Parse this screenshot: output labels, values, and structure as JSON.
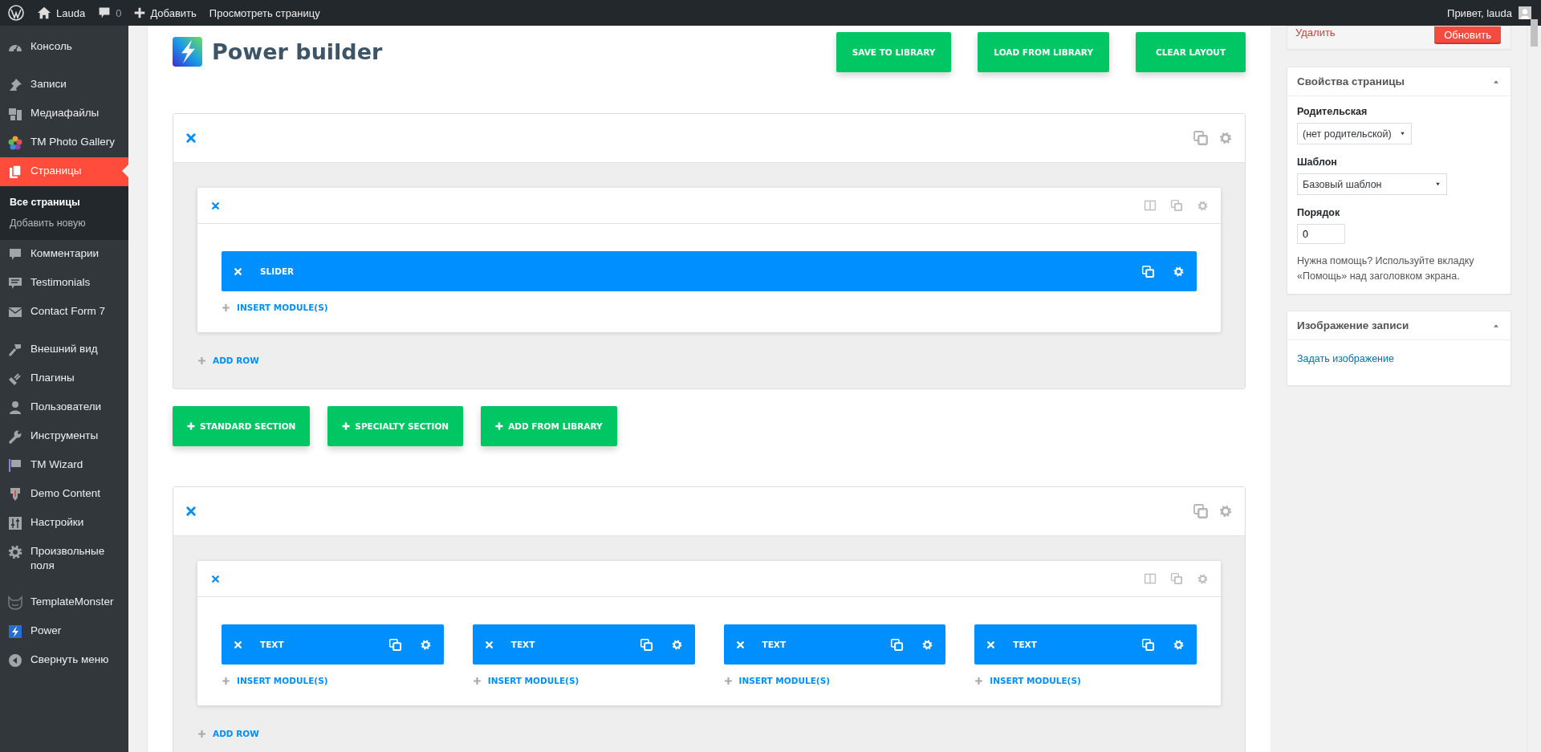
{
  "admin_bar": {
    "site": "Lauda",
    "comments": "0",
    "new": "Добавить",
    "view": "Просмотреть страницу",
    "greeting": "Привет, lauda"
  },
  "sidebar": {
    "items": [
      {
        "label": "Консоль",
        "selected": false
      },
      {
        "label": "Записи",
        "selected": false
      },
      {
        "label": "Медиафайлы",
        "selected": false
      },
      {
        "label": "TM Photo Gallery",
        "selected": false
      },
      {
        "label": "Страницы",
        "selected": true,
        "children": [
          {
            "label": "Все страницы",
            "selected": true
          },
          {
            "label": "Добавить новую",
            "selected": false
          }
        ]
      },
      {
        "label": "Комментарии",
        "selected": false
      },
      {
        "label": "Testimonials",
        "selected": false
      },
      {
        "label": "Contact Form 7",
        "selected": false
      },
      {
        "label": "Внешний вид",
        "selected": false
      },
      {
        "label": "Плагины",
        "selected": false
      },
      {
        "label": "Пользователи",
        "selected": false
      },
      {
        "label": "Инструменты",
        "selected": false
      },
      {
        "label": "TM Wizard",
        "selected": false
      },
      {
        "label": "Demo Content",
        "selected": false
      },
      {
        "label": "Настройки",
        "selected": false
      },
      {
        "label": "Произвольные поля",
        "selected": false
      },
      {
        "label": "TemplateMonster",
        "selected": false
      },
      {
        "label": "Power",
        "selected": false
      },
      {
        "label": "Свернуть меню",
        "selected": false
      }
    ]
  },
  "builder": {
    "title": "Power builder",
    "buttons": [
      "SAVE TO LIBRARY",
      "LOAD FROM LIBRARY",
      "CLEAR LAYOUT"
    ],
    "sections": [
      {
        "rows": [
          {
            "columns": [
              {
                "modules": [
                  "SLIDER"
                ],
                "insert": "INSERT MODULE(S)"
              }
            ]
          }
        ],
        "add_row": "ADD ROW"
      },
      {
        "rows": [
          {
            "columns": [
              {
                "modules": [
                  "TEXT"
                ],
                "insert": "INSERT MODULE(S)"
              },
              {
                "modules": [
                  "TEXT"
                ],
                "insert": "INSERT MODULE(S)"
              },
              {
                "modules": [
                  "TEXT"
                ],
                "insert": "INSERT MODULE(S)"
              },
              {
                "modules": [
                  "TEXT"
                ],
                "insert": "INSERT MODULE(S)"
              }
            ]
          }
        ],
        "add_row": "ADD ROW"
      }
    ],
    "section_buttons": [
      "STANDARD SECTION",
      "SPECIALTY SECTION",
      "ADD FROM LIBRARY"
    ]
  },
  "publish": {
    "delete": "Удалить",
    "update": "Обновить"
  },
  "page_attributes": {
    "title": "Свойства страницы",
    "parent_label": "Родительская",
    "parent_value": "(нет родительской)",
    "template_label": "Шаблон",
    "template_value": "Базовый шаблон",
    "order_label": "Порядок",
    "order_value": "0",
    "help": "Нужна помощь? Используйте вкладку «Помощь» над заголовком экрана."
  },
  "featured_image": {
    "title": "Изображение записи",
    "link": "Задать изображение"
  }
}
